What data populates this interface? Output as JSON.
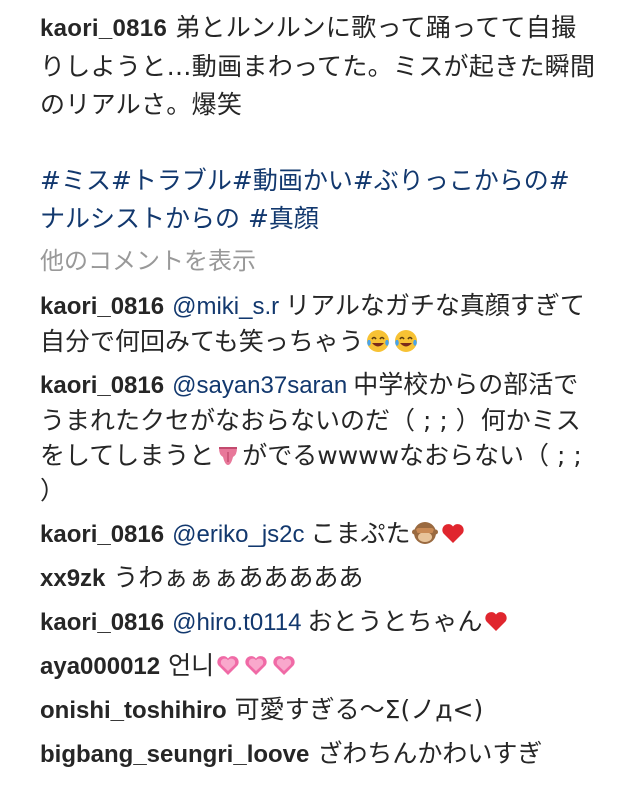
{
  "post": {
    "username": "kaori_0816",
    "caption": "弟とルンルンに歌って踊ってて自撮りしようと…動画まわってた。ミスが起きた瞬間のリアルさ。爆笑",
    "hashtags_line1": "#ミス#トラブル#動画かい#ぶりっこからの#",
    "hashtags_line2": "ナルシストからの #真顔"
  },
  "show_more_label": "他のコメントを表示",
  "comments": [
    {
      "user": "kaori_0816",
      "mention": "@miki_s.r",
      "text": "リアルなガチな真顔すぎて自分で何回みても笑っちゃう",
      "emojis": [
        "tears-of-joy-icon",
        "tears-of-joy-icon"
      ]
    },
    {
      "user": "kaori_0816",
      "mention": "@sayan37saran",
      "text_a": "中学校からの部活でうまれたクセがなおらないのだ（ ; ; ）何かミスをしてしまうと",
      "text_b": "がでるwwwwなおらない（ ; ; ）",
      "emojis": [
        "tongue-icon"
      ]
    },
    {
      "user": "kaori_0816",
      "mention": "@eriko_js2c",
      "text": "こまぷた",
      "emojis": [
        "see-no-evil-monkey-icon",
        "red-heart-icon"
      ]
    },
    {
      "user": "xx9zk",
      "text": "うわぁぁぁあああああ"
    },
    {
      "user": "kaori_0816",
      "mention": "@hiro.t0114",
      "text": "おとうとちゃん",
      "emojis": [
        "red-heart-icon"
      ]
    },
    {
      "user": "aya000012",
      "text": "언니",
      "emojis": [
        "pink-heart-icon",
        "pink-heart-icon",
        "pink-heart-icon"
      ]
    },
    {
      "user": "onishi_toshihiro",
      "text": "可愛すぎる〜Σ(ノд<)"
    },
    {
      "user": "bigbang_seungri_loove",
      "text": "ざわちんかわいすぎ"
    }
  ],
  "colors": {
    "link": "#12386e",
    "muted": "#999999",
    "text": "#262626",
    "background": "#ffffff"
  }
}
